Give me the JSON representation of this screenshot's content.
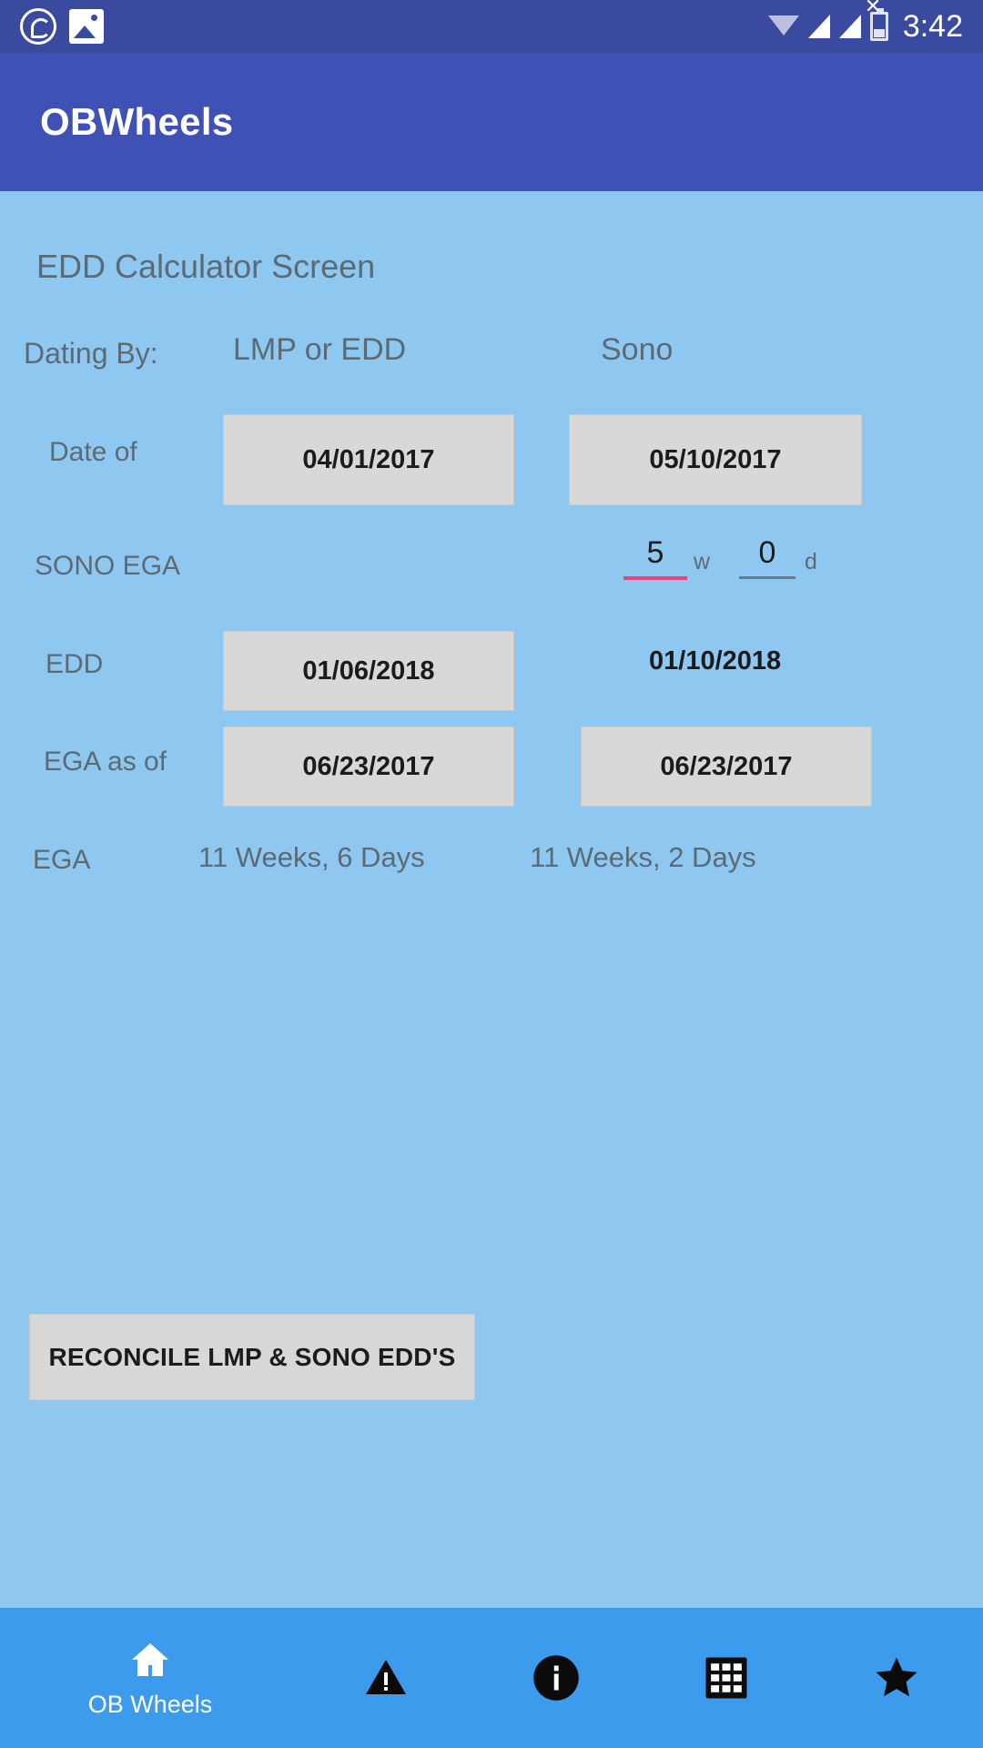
{
  "status_bar": {
    "time": "3:42",
    "icons": [
      "whatsapp-icon",
      "gallery-icon",
      "wifi-icon",
      "signal-icon-roaming",
      "signal-icon-no-service",
      "battery-icon"
    ]
  },
  "app_bar": {
    "title": "OBWheels"
  },
  "screen": {
    "title": "EDD Calculator Screen"
  },
  "table": {
    "dating_by_label": "Dating By:",
    "columns": [
      {
        "key": "lmp",
        "header": "LMP or EDD"
      },
      {
        "key": "sono",
        "header": "Sono"
      }
    ],
    "rows": [
      {
        "label": "Date of",
        "lmp_value": "04/01/2017",
        "sono_value": "05/10/2017"
      },
      {
        "label": "SONO EGA",
        "weeks": "5",
        "weeks_unit": "w",
        "days": "0",
        "days_unit": "d"
      },
      {
        "label": "EDD",
        "lmp_value": "01/06/2018",
        "sono_value": "01/10/2018"
      },
      {
        "label": "EGA as of",
        "lmp_value": "06/23/2017",
        "sono_value": "06/23/2017"
      },
      {
        "label": "EGA",
        "lmp_value": "11 Weeks, 6 Days",
        "sono_value": "11 Weeks, 2 Days"
      }
    ]
  },
  "actions": {
    "reconcile_label": "RECONCILE LMP & SONO EDD'S"
  },
  "bottom_nav": {
    "items": [
      {
        "icon": "home-icon",
        "label": "OB Wheels"
      },
      {
        "icon": "warning-triangle-icon",
        "label": ""
      },
      {
        "icon": "info-circle-icon",
        "label": ""
      },
      {
        "icon": "calculator-icon",
        "label": ""
      },
      {
        "icon": "star-icon",
        "label": ""
      }
    ]
  },
  "colors": {
    "status_bar": "#3a4a9e",
    "app_bar": "#4051b5",
    "background": "#8ec8f0",
    "bottom_nav": "#3d9bee",
    "field_bg": "#d8d8d8",
    "accent_underline": "#ef4173"
  }
}
